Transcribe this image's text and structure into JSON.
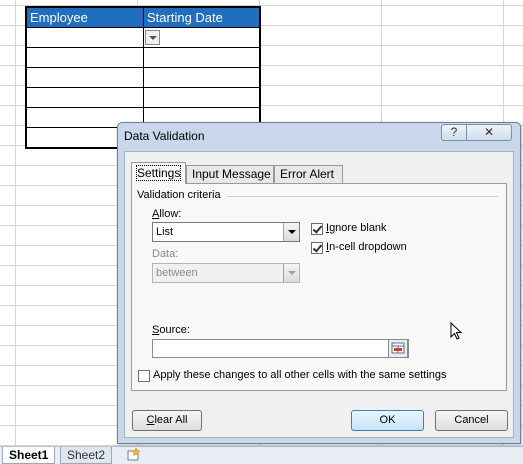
{
  "spreadsheet": {
    "columns": [
      "Employee",
      "Starting Date"
    ]
  },
  "sheet_tabs": [
    "Sheet1",
    "Sheet2"
  ],
  "dialog": {
    "title": "Data Validation",
    "help_label": "?",
    "close_label": "✕",
    "tabs": [
      "Settings",
      "Input Message",
      "Error Alert"
    ],
    "group_label": "Validation criteria",
    "allow": {
      "label": "Allow:",
      "value": "List"
    },
    "data": {
      "label": "Data:",
      "value": "between"
    },
    "source": {
      "label": "Source:",
      "value": ""
    },
    "ignore_blank": {
      "label": "Ignore blank",
      "checked": true
    },
    "in_cell_dropdown": {
      "label": "In-cell dropdown",
      "checked": true
    },
    "apply_all": {
      "label": "Apply these changes to all other cells with the same settings",
      "checked": false
    },
    "buttons": {
      "clear_all": "Clear All",
      "ok": "OK",
      "cancel": "Cancel"
    }
  }
}
